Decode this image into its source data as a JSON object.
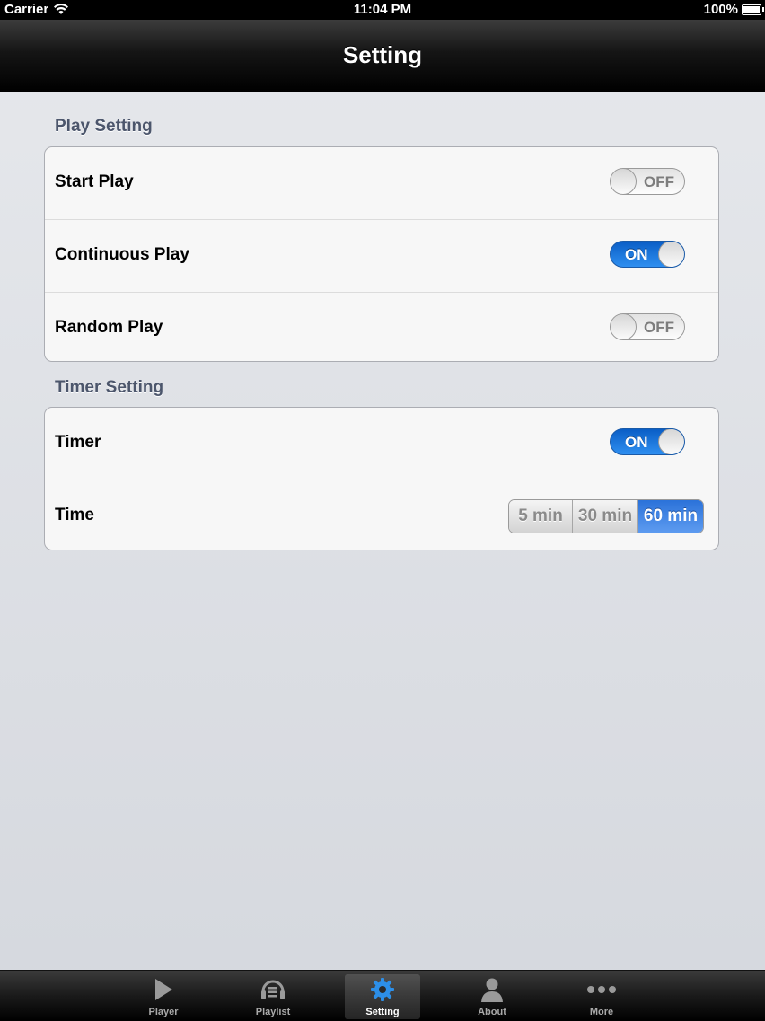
{
  "status_bar": {
    "carrier": "Carrier",
    "time": "11:04 PM",
    "battery": "100%"
  },
  "nav": {
    "title": "Setting"
  },
  "play_section": {
    "header": "Play Setting",
    "rows": [
      {
        "label": "Start Play",
        "switch_text": "OFF",
        "state": "off"
      },
      {
        "label": "Continuous Play",
        "switch_text": "ON",
        "state": "on"
      },
      {
        "label": "Random Play",
        "switch_text": "OFF",
        "state": "off"
      }
    ]
  },
  "timer_section": {
    "header": "Timer Setting",
    "timer": {
      "label": "Timer",
      "switch_text": "ON",
      "state": "on"
    },
    "time": {
      "label": "Time",
      "options": [
        "5 min",
        "30 min",
        "60 min"
      ],
      "selected": "60 min"
    }
  },
  "tab_bar": {
    "tabs": [
      {
        "label": "Player",
        "icon": "play-icon"
      },
      {
        "label": "Playlist",
        "icon": "playlist-icon"
      },
      {
        "label": "Setting",
        "icon": "gear-icon",
        "selected": true
      },
      {
        "label": "About",
        "icon": "person-icon"
      },
      {
        "label": "More",
        "icon": "more-icon"
      }
    ]
  },
  "colors": {
    "accent": "#2f8ff0",
    "selected_segment": "#3d83e3",
    "section_header": "#4c566c"
  }
}
